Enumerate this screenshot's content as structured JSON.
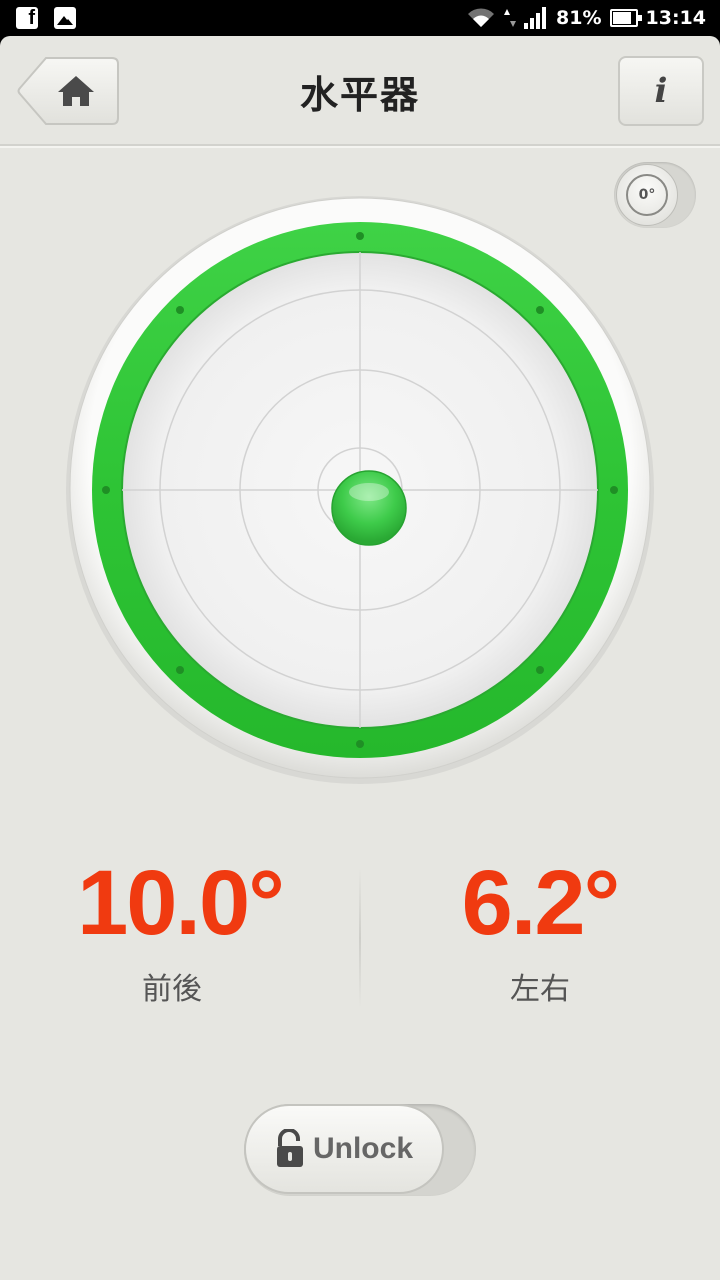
{
  "status_bar": {
    "battery_percent": "81%",
    "time": "13:14",
    "icons": [
      "facebook-icon",
      "image-icon",
      "wifi-icon",
      "data-arrows-icon",
      "signal-icon",
      "battery-icon"
    ]
  },
  "header": {
    "title": "水平器",
    "home_icon": "home-icon",
    "info_label": "i"
  },
  "calibration": {
    "label": "0°"
  },
  "level": {
    "bubble_color": "#3ecb4a",
    "ring_color": "#33c63a"
  },
  "readouts": {
    "front_back": {
      "value": "10.0°",
      "label": "前後"
    },
    "left_right": {
      "value": "6.2°",
      "label": "左右"
    }
  },
  "colors": {
    "value_color": "#f03a10",
    "background": "#e6e6e1"
  },
  "lock": {
    "label": "Unlock",
    "icon": "unlock-icon"
  }
}
